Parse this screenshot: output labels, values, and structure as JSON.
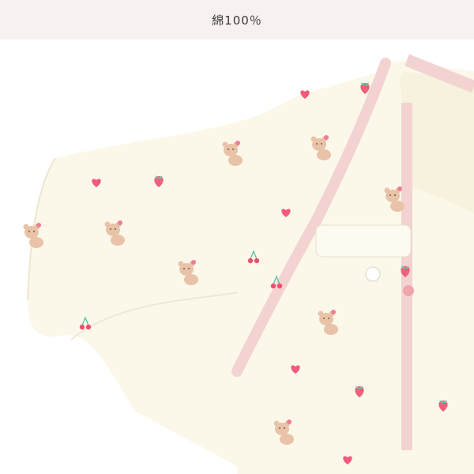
{
  "banner": {
    "material_label": "綿100％",
    "background_color": "#f7f1ef"
  },
  "product_photo": {
    "fabric_color": "#fbf8ea",
    "trim_color": "#f3d3d1",
    "snap_color": "#f2a4ad",
    "print_motifs": [
      "bear",
      "heart",
      "strawberry",
      "cherry"
    ]
  }
}
